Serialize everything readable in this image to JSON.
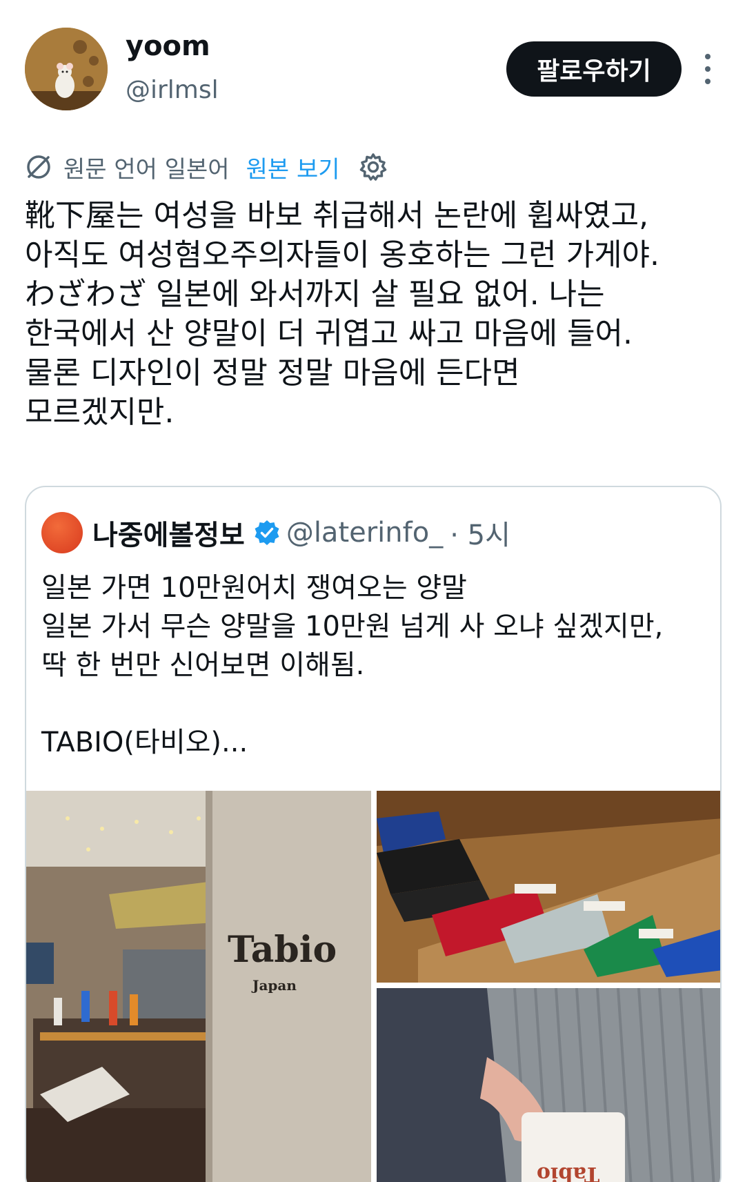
{
  "author": {
    "display_name": "yoom",
    "handle": "@irlmsl"
  },
  "follow_label": "팔로우하기",
  "translation": {
    "language_note": "원문 언어 일본어",
    "view_original": "원본 보기"
  },
  "tweet_lines": [
    "靴下屋는 여성을 바보 취급해서 논란에 휩싸였고,",
    "아직도 여성혐오주의자들이 옹호하는 그런 가게야.",
    "わざわざ 일본에 와서까지 살 필요 없어. 나는",
    "한국에서 산 양말이 더 귀엽고 싸고 마음에 들어.",
    "물론 디자인이 정말 정말 마음에 든다면",
    "모르겠지만."
  ],
  "quote": {
    "name": "나중에볼정보",
    "handle": "@laterinfo_",
    "time": "· 5시",
    "lines": [
      "일본 가면 10만원어치 쟁여오는 양말",
      "일본 가서 무슨 양말을 10만원 넘게 사 오냐 싶겠지만,",
      "딱 한 번만 신어보면 이해됨.",
      "",
      "TABIO(타비오)..."
    ]
  },
  "media": {
    "logo_text": "Tabio",
    "logo_sub": "Japan",
    "tag_text": "Tabio"
  },
  "colors": {
    "link": "#1d9bf0",
    "muted": "#536471",
    "text": "#0f1419",
    "border": "#cfd9de"
  }
}
